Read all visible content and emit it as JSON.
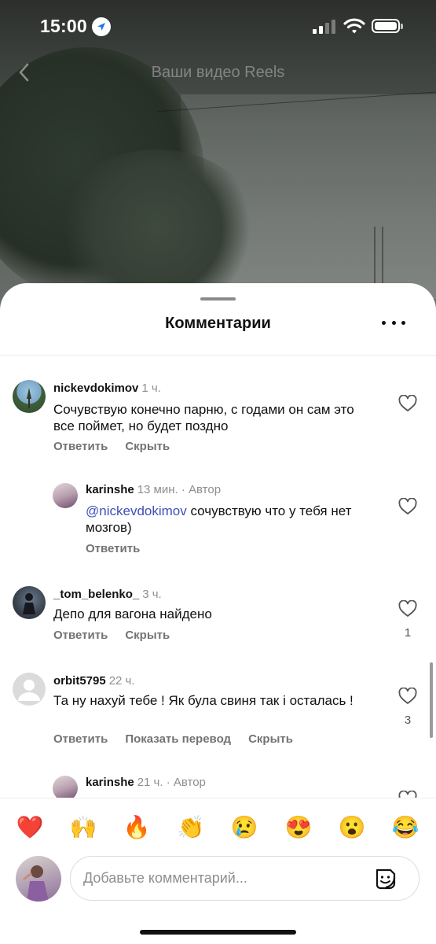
{
  "status_bar": {
    "time": "15:00"
  },
  "header": {
    "title": "Ваши видео Reels"
  },
  "sheet": {
    "title": "Комментарии"
  },
  "comments": [
    {
      "user": "nickevdokimov",
      "time": "1 ч.",
      "text": "Сочувствую конечно парню, с годами он сам это все поймет, но будет поздно",
      "actions": [
        "Ответить",
        "Скрыть"
      ]
    },
    {
      "user": "karinshe",
      "time": "13 мин. · Автор",
      "mention": "@nickevdokimov",
      "text": " сочувствую что у тебя нет мозгов)",
      "actions": [
        "Ответить"
      ]
    },
    {
      "user": "_tom_belenko_",
      "time": "3 ч.",
      "text": "Депо для вагона найдено",
      "actions": [
        "Ответить",
        "Скрыть"
      ],
      "likes": "1"
    },
    {
      "user": "orbit5795",
      "time": "22 ч.",
      "text": "Та ну нахуй тебе !  Як була свиня так і осталась !",
      "actions": [
        "Ответить",
        "Показать перевод",
        "Скрыть"
      ],
      "likes": "3"
    },
    {
      "user": "karinshe",
      "time": "21 ч. · Автор"
    }
  ],
  "emoji_bar": [
    "❤️",
    "🙌",
    "🔥",
    "👏",
    "😢",
    "😍",
    "😮",
    "😂"
  ],
  "composer": {
    "placeholder": "Добавьте комментарий..."
  },
  "icons": {
    "back": "chevron-left-icon",
    "location": "location-arrow-icon",
    "more": "more-horizontal-icon",
    "like": "heart-outline-icon",
    "sticker": "sticker-icon"
  }
}
